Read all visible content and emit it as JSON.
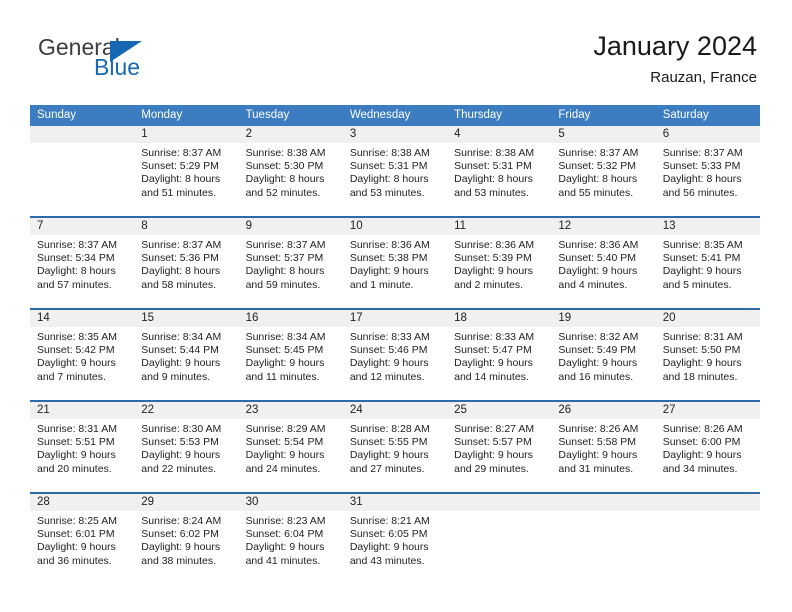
{
  "brand": {
    "name_top": "General",
    "name_bottom": "Blue",
    "triangle_icon": "triangle-logo-icon",
    "accent_color": "#1668b3"
  },
  "header": {
    "title": "January 2024",
    "subtitle": "Rauzan, France"
  },
  "theme": {
    "header_row_bg": "#3b7dc0",
    "row_divider": "#2c6aa8",
    "daynum_band_bg": "#f0f0f0",
    "page_bg": "#ffffff"
  },
  "weekday_headers": [
    "Sunday",
    "Monday",
    "Tuesday",
    "Wednesday",
    "Thursday",
    "Friday",
    "Saturday"
  ],
  "weeks": [
    [
      {
        "day": "",
        "sunrise": "",
        "sunset": "",
        "daylight_1": "",
        "daylight_2": "",
        "empty": true
      },
      {
        "day": "1",
        "sunrise": "Sunrise: 8:37 AM",
        "sunset": "Sunset: 5:29 PM",
        "daylight_1": "Daylight: 8 hours",
        "daylight_2": "and 51 minutes."
      },
      {
        "day": "2",
        "sunrise": "Sunrise: 8:38 AM",
        "sunset": "Sunset: 5:30 PM",
        "daylight_1": "Daylight: 8 hours",
        "daylight_2": "and 52 minutes."
      },
      {
        "day": "3",
        "sunrise": "Sunrise: 8:38 AM",
        "sunset": "Sunset: 5:31 PM",
        "daylight_1": "Daylight: 8 hours",
        "daylight_2": "and 53 minutes."
      },
      {
        "day": "4",
        "sunrise": "Sunrise: 8:38 AM",
        "sunset": "Sunset: 5:31 PM",
        "daylight_1": "Daylight: 8 hours",
        "daylight_2": "and 53 minutes."
      },
      {
        "day": "5",
        "sunrise": "Sunrise: 8:37 AM",
        "sunset": "Sunset: 5:32 PM",
        "daylight_1": "Daylight: 8 hours",
        "daylight_2": "and 55 minutes."
      },
      {
        "day": "6",
        "sunrise": "Sunrise: 8:37 AM",
        "sunset": "Sunset: 5:33 PM",
        "daylight_1": "Daylight: 8 hours",
        "daylight_2": "and 56 minutes."
      }
    ],
    [
      {
        "day": "7",
        "sunrise": "Sunrise: 8:37 AM",
        "sunset": "Sunset: 5:34 PM",
        "daylight_1": "Daylight: 8 hours",
        "daylight_2": "and 57 minutes."
      },
      {
        "day": "8",
        "sunrise": "Sunrise: 8:37 AM",
        "sunset": "Sunset: 5:36 PM",
        "daylight_1": "Daylight: 8 hours",
        "daylight_2": "and 58 minutes."
      },
      {
        "day": "9",
        "sunrise": "Sunrise: 8:37 AM",
        "sunset": "Sunset: 5:37 PM",
        "daylight_1": "Daylight: 8 hours",
        "daylight_2": "and 59 minutes."
      },
      {
        "day": "10",
        "sunrise": "Sunrise: 8:36 AM",
        "sunset": "Sunset: 5:38 PM",
        "daylight_1": "Daylight: 9 hours",
        "daylight_2": "and 1 minute."
      },
      {
        "day": "11",
        "sunrise": "Sunrise: 8:36 AM",
        "sunset": "Sunset: 5:39 PM",
        "daylight_1": "Daylight: 9 hours",
        "daylight_2": "and 2 minutes."
      },
      {
        "day": "12",
        "sunrise": "Sunrise: 8:36 AM",
        "sunset": "Sunset: 5:40 PM",
        "daylight_1": "Daylight: 9 hours",
        "daylight_2": "and 4 minutes."
      },
      {
        "day": "13",
        "sunrise": "Sunrise: 8:35 AM",
        "sunset": "Sunset: 5:41 PM",
        "daylight_1": "Daylight: 9 hours",
        "daylight_2": "and 5 minutes."
      }
    ],
    [
      {
        "day": "14",
        "sunrise": "Sunrise: 8:35 AM",
        "sunset": "Sunset: 5:42 PM",
        "daylight_1": "Daylight: 9 hours",
        "daylight_2": "and 7 minutes."
      },
      {
        "day": "15",
        "sunrise": "Sunrise: 8:34 AM",
        "sunset": "Sunset: 5:44 PM",
        "daylight_1": "Daylight: 9 hours",
        "daylight_2": "and 9 minutes."
      },
      {
        "day": "16",
        "sunrise": "Sunrise: 8:34 AM",
        "sunset": "Sunset: 5:45 PM",
        "daylight_1": "Daylight: 9 hours",
        "daylight_2": "and 11 minutes."
      },
      {
        "day": "17",
        "sunrise": "Sunrise: 8:33 AM",
        "sunset": "Sunset: 5:46 PM",
        "daylight_1": "Daylight: 9 hours",
        "daylight_2": "and 12 minutes."
      },
      {
        "day": "18",
        "sunrise": "Sunrise: 8:33 AM",
        "sunset": "Sunset: 5:47 PM",
        "daylight_1": "Daylight: 9 hours",
        "daylight_2": "and 14 minutes."
      },
      {
        "day": "19",
        "sunrise": "Sunrise: 8:32 AM",
        "sunset": "Sunset: 5:49 PM",
        "daylight_1": "Daylight: 9 hours",
        "daylight_2": "and 16 minutes."
      },
      {
        "day": "20",
        "sunrise": "Sunrise: 8:31 AM",
        "sunset": "Sunset: 5:50 PM",
        "daylight_1": "Daylight: 9 hours",
        "daylight_2": "and 18 minutes."
      }
    ],
    [
      {
        "day": "21",
        "sunrise": "Sunrise: 8:31 AM",
        "sunset": "Sunset: 5:51 PM",
        "daylight_1": "Daylight: 9 hours",
        "daylight_2": "and 20 minutes."
      },
      {
        "day": "22",
        "sunrise": "Sunrise: 8:30 AM",
        "sunset": "Sunset: 5:53 PM",
        "daylight_1": "Daylight: 9 hours",
        "daylight_2": "and 22 minutes."
      },
      {
        "day": "23",
        "sunrise": "Sunrise: 8:29 AM",
        "sunset": "Sunset: 5:54 PM",
        "daylight_1": "Daylight: 9 hours",
        "daylight_2": "and 24 minutes."
      },
      {
        "day": "24",
        "sunrise": "Sunrise: 8:28 AM",
        "sunset": "Sunset: 5:55 PM",
        "daylight_1": "Daylight: 9 hours",
        "daylight_2": "and 27 minutes."
      },
      {
        "day": "25",
        "sunrise": "Sunrise: 8:27 AM",
        "sunset": "Sunset: 5:57 PM",
        "daylight_1": "Daylight: 9 hours",
        "daylight_2": "and 29 minutes."
      },
      {
        "day": "26",
        "sunrise": "Sunrise: 8:26 AM",
        "sunset": "Sunset: 5:58 PM",
        "daylight_1": "Daylight: 9 hours",
        "daylight_2": "and 31 minutes."
      },
      {
        "day": "27",
        "sunrise": "Sunrise: 8:26 AM",
        "sunset": "Sunset: 6:00 PM",
        "daylight_1": "Daylight: 9 hours",
        "daylight_2": "and 34 minutes."
      }
    ],
    [
      {
        "day": "28",
        "sunrise": "Sunrise: 8:25 AM",
        "sunset": "Sunset: 6:01 PM",
        "daylight_1": "Daylight: 9 hours",
        "daylight_2": "and 36 minutes."
      },
      {
        "day": "29",
        "sunrise": "Sunrise: 8:24 AM",
        "sunset": "Sunset: 6:02 PM",
        "daylight_1": "Daylight: 9 hours",
        "daylight_2": "and 38 minutes."
      },
      {
        "day": "30",
        "sunrise": "Sunrise: 8:23 AM",
        "sunset": "Sunset: 6:04 PM",
        "daylight_1": "Daylight: 9 hours",
        "daylight_2": "and 41 minutes."
      },
      {
        "day": "31",
        "sunrise": "Sunrise: 8:21 AM",
        "sunset": "Sunset: 6:05 PM",
        "daylight_1": "Daylight: 9 hours",
        "daylight_2": "and 43 minutes."
      },
      {
        "day": "",
        "sunrise": "",
        "sunset": "",
        "daylight_1": "",
        "daylight_2": "",
        "empty": true
      },
      {
        "day": "",
        "sunrise": "",
        "sunset": "",
        "daylight_1": "",
        "daylight_2": "",
        "empty": true
      },
      {
        "day": "",
        "sunrise": "",
        "sunset": "",
        "daylight_1": "",
        "daylight_2": "",
        "empty": true
      }
    ]
  ]
}
